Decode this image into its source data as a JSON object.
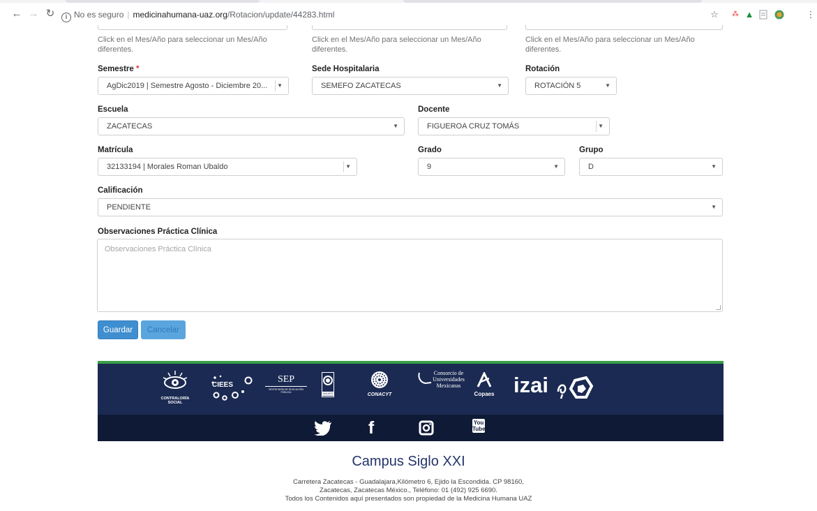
{
  "browser": {
    "security_label": "No es seguro",
    "host": "medicinahumana-uaz.org",
    "path": "/Rotacion/update/44283.html"
  },
  "hints": {
    "col1": "Click en el Mes/Año para seleccionar un Mes/Año diferentes.",
    "col2": "Click en el Mes/Año para seleccionar un Mes/Año diferentes.",
    "col3": "Click en el Mes/Año para seleccionar un Mes/Año diferentes."
  },
  "form": {
    "semestre": {
      "label": "Semestre",
      "required_mark": "*",
      "value": "AgDic2019 | Semestre Agosto - Diciembre 20..."
    },
    "sede": {
      "label": "Sede Hospitalaria",
      "value": "SEMEFO ZACATECAS"
    },
    "rotacion": {
      "label": "Rotación",
      "value": "ROTACIÓN 5"
    },
    "escuela": {
      "label": "Escuela",
      "value": "ZACATECAS"
    },
    "docente": {
      "label": "Docente",
      "value": "FIGUEROA CRUZ TOMÁS"
    },
    "matricula": {
      "label": "Matrícula",
      "value": "32133194 | Morales Roman Ubaldo"
    },
    "grado": {
      "label": "Grado",
      "value": "9"
    },
    "grupo": {
      "label": "Grupo",
      "value": "D"
    },
    "calificacion": {
      "label": "Calificación",
      "value": "PENDIENTE"
    },
    "observaciones": {
      "label": "Observaciones Práctica Clínica",
      "placeholder": "Observaciones Práctica Clínica"
    },
    "save_label": "Guardar",
    "cancel_label": "Cancelar"
  },
  "footer": {
    "logos": {
      "contraloria": "CONTRALORÍA SOCIAL",
      "ciees": "CIEES",
      "sep": "SEP",
      "sep_sub": "SECRETARÍA DE EDUCACIÓN PÚBLICA",
      "anuies": "ANUIES",
      "conacyt": "CONACYT",
      "cum": "Consorcio de Universidades Mexicanas",
      "copaes": "Copaes",
      "izai": "izai"
    },
    "social": {
      "youtube_text": "You Tube"
    },
    "campus_title": "Campus Siglo XXI",
    "address_line1": "Carretera Zacatecas - Guadalajara,Kilómetro 6, Ejido la Escondida. CP 98160,",
    "address_line2": "Zacatecas, Zacatecas México., Teléfono: 01 (492) 925 6690.",
    "address_line3": "Todos los Contenidos aquí presentados son propiedad de la Medicina Humana UAZ"
  },
  "colors": {
    "primary_button": "#3f8ecf",
    "footer_navy": "#1b2a52",
    "footer_dark": "#0f1a36",
    "footer_green": "#37a046",
    "campus_title": "#24356a"
  }
}
